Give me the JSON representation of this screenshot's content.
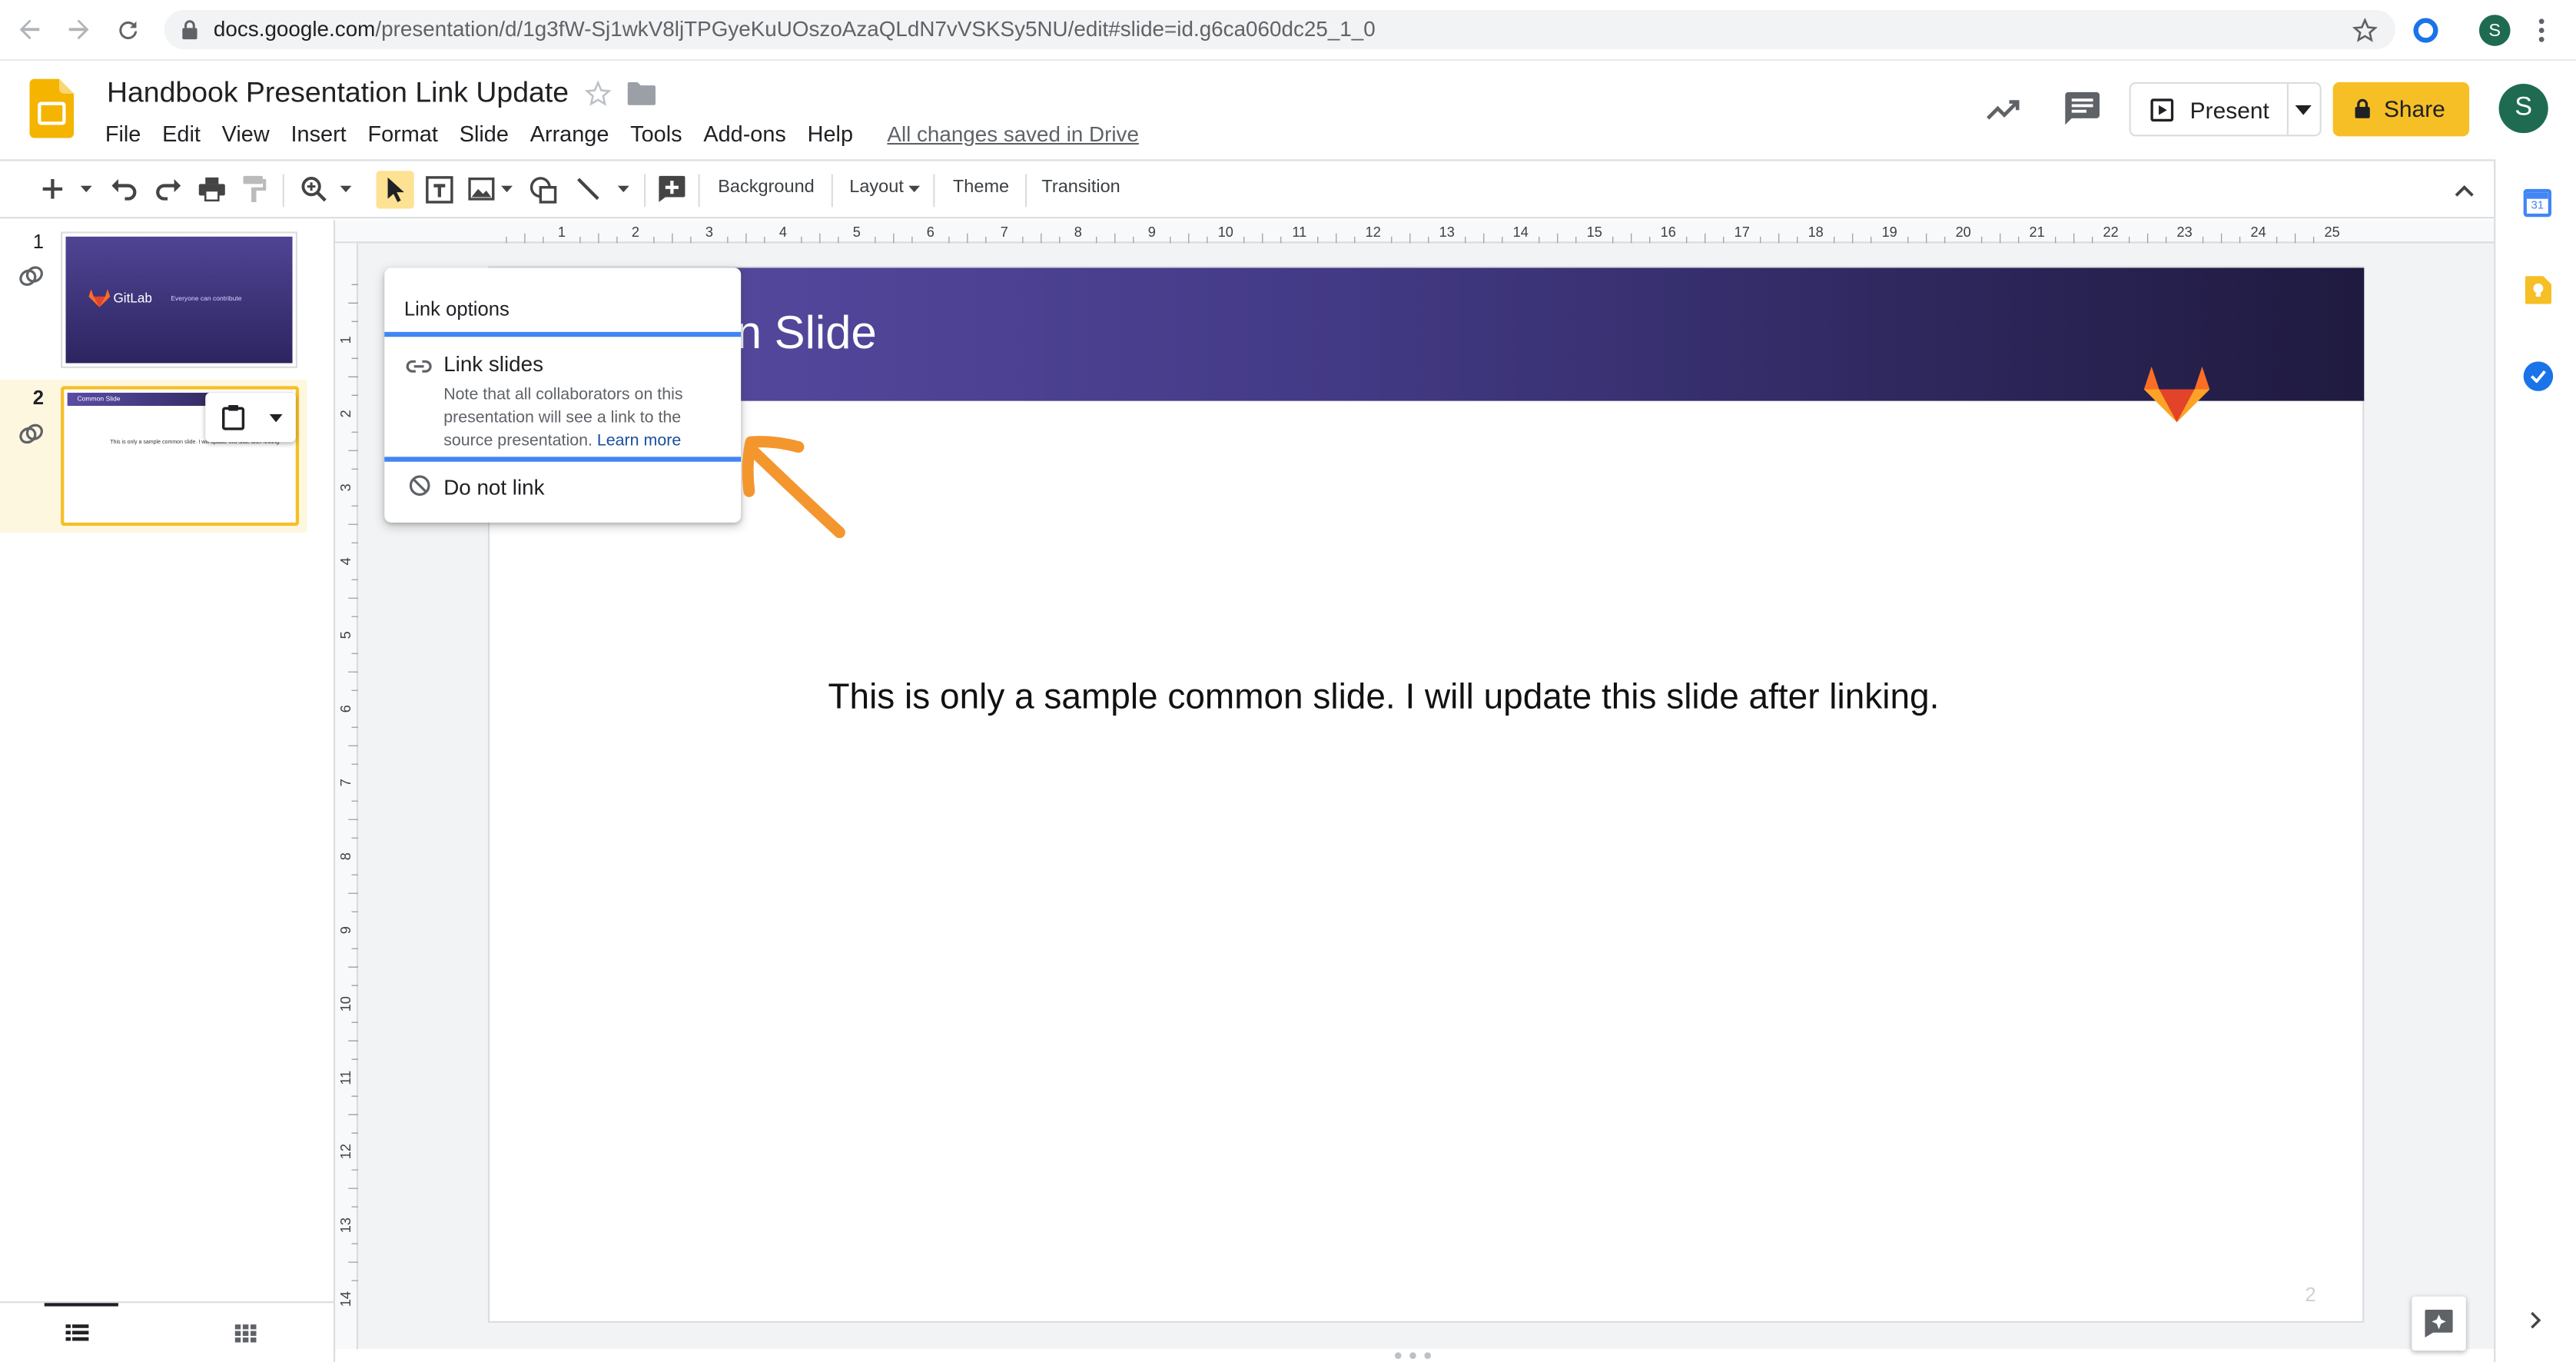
{
  "browser": {
    "url_host": "docs.google.com",
    "url_path": "/presentation/d/1g3fW-Sj1wkV8ljTPGyeKuUOszoAzaQLdN7vVSKSy5NU/edit#slide=id.g6ca060dc25_1_0",
    "profile_initial": "S"
  },
  "doc": {
    "title": "Handbook Presentation Link Update",
    "saved_status": "All changes saved in Drive"
  },
  "menu": [
    "File",
    "Edit",
    "View",
    "Insert",
    "Format",
    "Slide",
    "Arrange",
    "Tools",
    "Add-ons",
    "Help"
  ],
  "header": {
    "present_label": "Present",
    "share_label": "Share",
    "account_initial": "S"
  },
  "toolbar": {
    "background_label": "Background",
    "layout_label": "Layout",
    "theme_label": "Theme",
    "transition_label": "Transition"
  },
  "filmstrip": {
    "slides": [
      {
        "number": "1",
        "brand": "GitLab",
        "tagline": "Everyone can contribute"
      },
      {
        "number": "2",
        "title": "Common Slide",
        "body": "This is only a sample common slide. I will update this slide after linking."
      }
    ]
  },
  "ruler": {
    "h_ticks": [
      "1",
      "2",
      "3",
      "4",
      "5",
      "6",
      "7",
      "8",
      "9",
      "10",
      "11",
      "12",
      "13",
      "14",
      "15",
      "16",
      "17",
      "18",
      "19",
      "20",
      "21",
      "22",
      "23",
      "24",
      "25"
    ],
    "v_ticks": [
      "1",
      "2",
      "3",
      "4",
      "5",
      "6",
      "7",
      "8",
      "9",
      "10",
      "11",
      "12",
      "13",
      "14"
    ]
  },
  "slide": {
    "title_visible": "n Slide",
    "body": "This is only a sample common slide. I will update this slide after linking.",
    "page_number": "2"
  },
  "link_popup": {
    "header": "Link options",
    "link_slides_label": "Link slides",
    "link_slides_note": "Note that all collaborators on this presentation will see a link to the source presentation.",
    "learn_more": "Learn more",
    "do_not_link_label": "Do not link"
  },
  "colors": {
    "slide_header_start": "#5a4ca5",
    "slide_header_end": "#1f1a3f",
    "share_button": "#f6bf26",
    "annotation_arrow": "#f4962e",
    "selection_blue": "#4285f4",
    "avatar_green": "#1e6b52"
  }
}
